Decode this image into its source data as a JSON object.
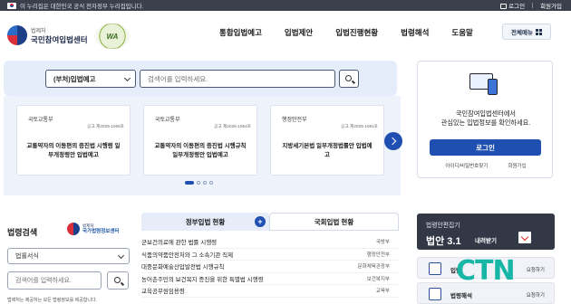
{
  "gov_bar": {
    "notice": "이 누리집은 대한민국 공식 전자정부 누리집입니다.",
    "login": "로그인",
    "signup": "회원가입"
  },
  "header": {
    "org_small": "법제처",
    "org_name": "국민참여입법센터",
    "badge": "WA",
    "nav": [
      "통합입법예고",
      "입법제안",
      "입법진행현황",
      "법령해석",
      "도움말"
    ],
    "all_menu": "전체메뉴"
  },
  "search": {
    "selected": "(부처)입법예고",
    "placeholder": "검색어를 입력하세요."
  },
  "notices": [
    {
      "dept": "국토교통부",
      "no": "공고 제2025-1066호",
      "title": "교통약자의 이동편의 증진법 시행령 일부개정령안 입법예고"
    },
    {
      "dept": "국토교통부",
      "no": "공고 제2025-1064호",
      "title": "교통약자의 이동편의 증진법 시행규칙 일부개정령안 입법예고"
    },
    {
      "dept": "행정안전부",
      "no": "공고 제2025-1081호",
      "title": "지방세기본법 일부개정법률안 입법예고"
    }
  ],
  "login_card": {
    "message_line1": "국민참여입법센터에서",
    "message_line2": "관심있는 입법정보를 확인하세요.",
    "login_button": "로그인",
    "find_id": "아이디/비밀번호찾기",
    "signup": "회원가입"
  },
  "law_search": {
    "heading": "법령검색",
    "logo_small": "법제처",
    "logo_name": "국가법령정보센터",
    "selected": "법률서식",
    "placeholder": "검색어를 입력하세요.",
    "note": "법제처는 제공하는 모든 법령정보를 제공합니다."
  },
  "tabs": {
    "active": "정부입법 현황",
    "inactive": "국회입법 현황"
  },
  "bills": [
    {
      "title": "군보건의료에 관한 법률 시행령",
      "ministry": "국방부"
    },
    {
      "title": "식품의약품안전처와 그 소속기관 직제",
      "ministry": "행정안전부"
    },
    {
      "title": "대중문화예술산업발전법 시행규칙",
      "ministry": "문화체육관광부"
    },
    {
      "title": "농어촌주민의 보건복지 증진을 위한 특별법 시행령",
      "ministry": "보건복지부"
    },
    {
      "title": "교육공무원임용령",
      "ministry": "교육부"
    }
  ],
  "stat_box": {
    "label": "법령안편집기",
    "version": "법안 3.1",
    "download": "내려받기"
  },
  "services": [
    {
      "label": "입법",
      "action": "요청하기"
    },
    {
      "label": "법령해석",
      "action": "요청하기"
    }
  ],
  "watermark": "CTN"
}
